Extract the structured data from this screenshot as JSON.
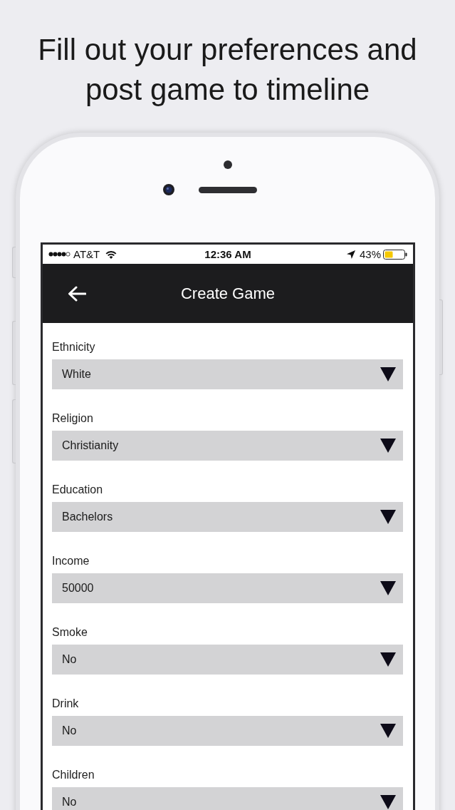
{
  "headline": "Fill out your preferences and post game to timeline",
  "status_bar": {
    "carrier": "AT&T",
    "time": "12:36 AM",
    "battery": "43%"
  },
  "nav_bar": {
    "title": "Create Game"
  },
  "form": {
    "fields": [
      {
        "label": "Ethnicity",
        "value": "White"
      },
      {
        "label": "Religion",
        "value": "Christianity"
      },
      {
        "label": "Education",
        "value": "Bachelors"
      },
      {
        "label": "Income",
        "value": "50000"
      },
      {
        "label": "Smoke",
        "value": "No"
      },
      {
        "label": "Drink",
        "value": "No"
      },
      {
        "label": "Children",
        "value": "No"
      }
    ]
  }
}
